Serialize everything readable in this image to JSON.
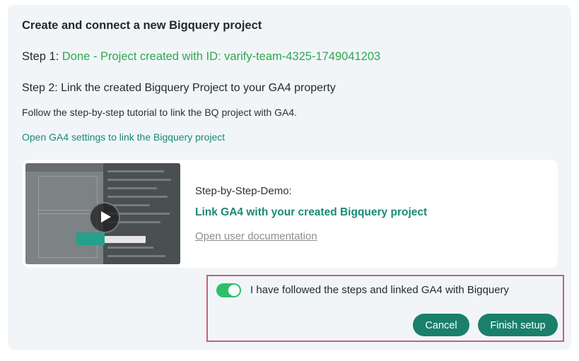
{
  "header": {
    "title": "Create and connect a new Bigquery project"
  },
  "step1": {
    "label": "Step 1:",
    "status": "Done - Project created with ID: varify-team-4325-1749041203"
  },
  "step2": {
    "title": "Step 2: Link the created Bigquery Project to your GA4 property",
    "instructions": "Follow the step-by-step tutorial to link the BQ project with GA4.",
    "settings_link": "Open GA4 settings to link the Bigquery project"
  },
  "demo": {
    "label": "Step-by-Step-Demo:",
    "video_link": "Link GA4 with your created Bigquery project",
    "docs_link": "Open user documentation",
    "play_icon": "play-icon"
  },
  "confirmation": {
    "toggle_on": true,
    "toggle_color": "#2fbf6c",
    "text": "I have followed the steps and linked GA4 with Bigquery"
  },
  "actions": {
    "cancel_label": "Cancel",
    "finish_label": "Finish setup",
    "button_color": "#1a7f6b"
  },
  "colors": {
    "success": "#2fa84f",
    "link": "#1a8a74",
    "highlight_border": "#c26470"
  }
}
